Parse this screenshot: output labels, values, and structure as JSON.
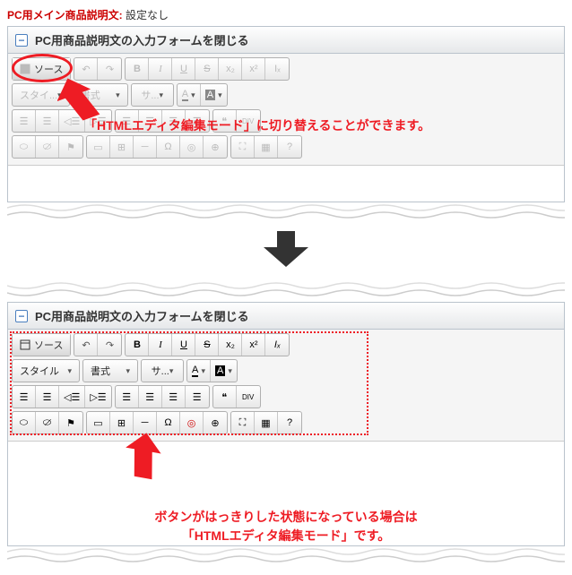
{
  "header": {
    "label": "PC用メイン商品説明文:",
    "value": "設定なし"
  },
  "panel1": {
    "title": "PC用商品説明文の入力フォームを閉じる",
    "source_btn": "ソース",
    "dropdowns": {
      "style": "スタイ...",
      "format": "書式",
      "size": "サ..."
    },
    "callout": "「HTMLエディタ編集モード」に切り替えることができます。"
  },
  "panel2": {
    "title": "PC用商品説明文の入力フォームを閉じる",
    "source_btn": "ソース",
    "dropdowns": {
      "style": "スタイル",
      "format": "書式",
      "size": "サ..."
    },
    "callout_line1": "ボタンがはっきりした状態になっている場合は",
    "callout_line2": "「HTMLエディタ編集モード」です。"
  },
  "toolbar_icons": {
    "undo": "↶",
    "redo": "↷",
    "b": "B",
    "i": "I",
    "u": "U",
    "s": "S",
    "sub": "x₂",
    "sup": "x²",
    "clear": "Iₓ",
    "a": "A",
    "bg": "A",
    "ol": "≡",
    "ul": "≡",
    "outdent": "≡",
    "indent": "≡",
    "left": "≡",
    "center": "≡",
    "right": "≡",
    "justify": "≡",
    "quote": "❝",
    "div": "DIV",
    "link": "🔗",
    "unlink": "⛓",
    "anchor": "⚑",
    "image": "🖼",
    "table": "⊞",
    "hr": "—",
    "special": "Ω",
    "embed": "▣",
    "world": "🌐",
    "maximize": "⛶",
    "blocks": "▦",
    "help": "?"
  }
}
